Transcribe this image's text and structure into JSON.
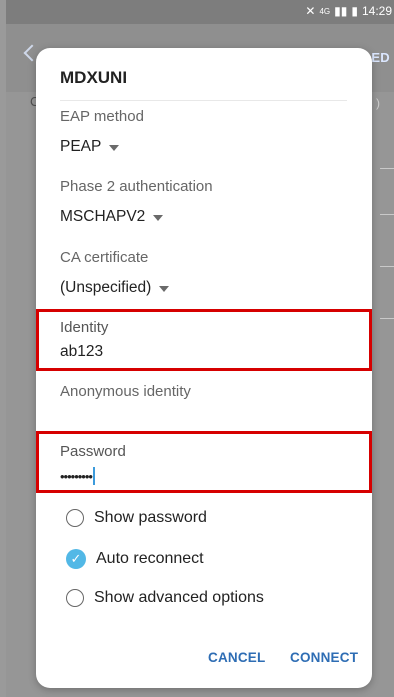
{
  "statusbar": {
    "network": "4G",
    "time": "14:29"
  },
  "background": {
    "advanced_label": "ED",
    "row_letter": "C",
    "row_paren": ")"
  },
  "dialog": {
    "title": "MDXUNI",
    "eap": {
      "label": "EAP method",
      "value": "PEAP"
    },
    "phase2": {
      "label": "Phase 2 authentication",
      "value": "MSCHAPV2"
    },
    "ca": {
      "label": "CA certificate",
      "value": "(Unspecified)"
    },
    "identity": {
      "label": "Identity",
      "value": "ab123"
    },
    "anonymous": {
      "label": "Anonymous identity",
      "value": ""
    },
    "password": {
      "label": "Password",
      "value": "•••••••••"
    },
    "options": {
      "show_password": "Show password",
      "auto_reconnect": "Auto reconnect",
      "show_advanced": "Show advanced options"
    },
    "cancel": "CANCEL",
    "connect": "CONNECT"
  },
  "colors": {
    "accent": "#2e6db4",
    "highlight": "#d60000",
    "checked": "#52b8e6"
  }
}
